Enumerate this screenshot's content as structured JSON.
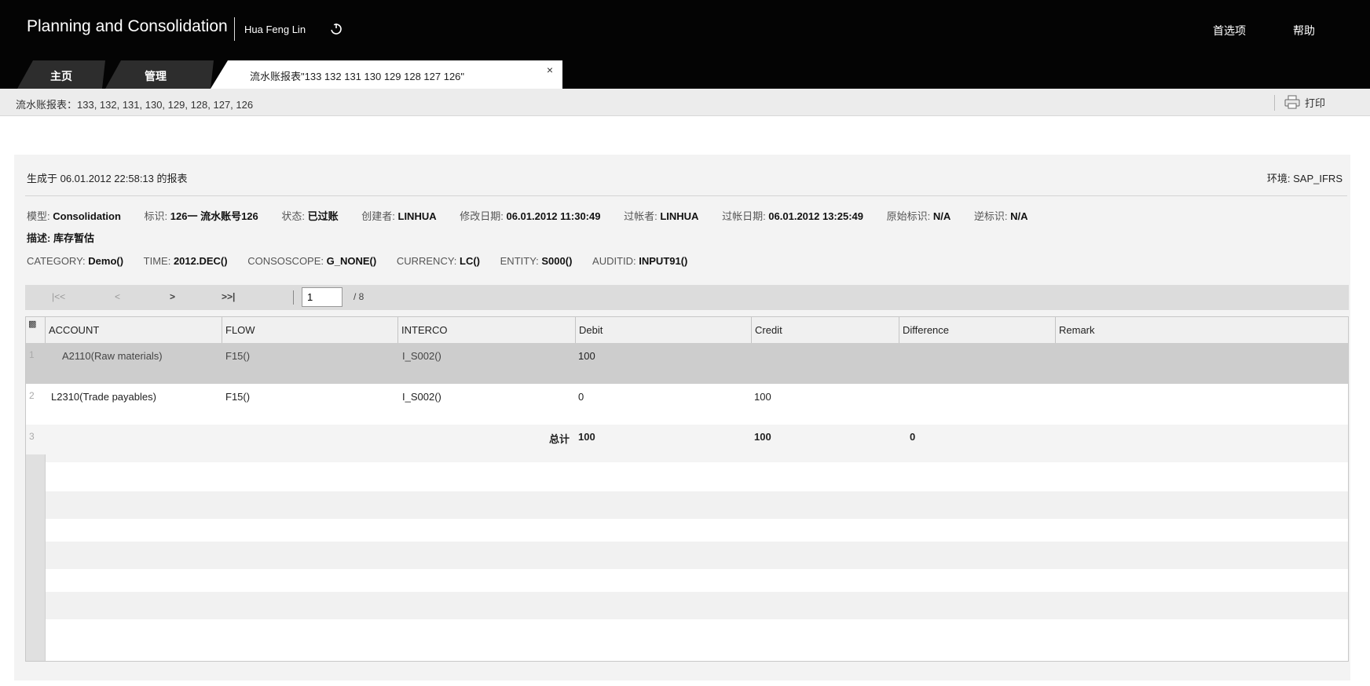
{
  "header": {
    "app_title": "Planning and Consolidation",
    "user": "Hua Feng Lin",
    "links": [
      "首选项",
      "帮助"
    ]
  },
  "tabs": [
    {
      "label": "主页"
    },
    {
      "label": "管理"
    },
    {
      "label": "流水账报表\"133 132 131 130 129 128 127 126\"",
      "close": "×"
    }
  ],
  "subbar": {
    "title": "流水账报表：133, 132, 131, 130, 129, 128, 127, 126",
    "print_label": "打印"
  },
  "report": {
    "generated": "生成于 06.01.2012 22:58:13 的报表",
    "env_label": "环境: ",
    "env_value": "SAP_IFRS",
    "meta": [
      {
        "label": "模型: ",
        "value": "Consolidation"
      },
      {
        "label": "标识: ",
        "value": "126一 流水账号126"
      },
      {
        "label": "状态: ",
        "value": "已过账"
      },
      {
        "label": "创建者: ",
        "value": "LINHUA"
      },
      {
        "label": "修改日期: ",
        "value": "06.01.2012 11:30:49"
      },
      {
        "label": "过帐者: ",
        "value": "LINHUA"
      },
      {
        "label": "过帐日期: ",
        "value": "06.01.2012 13:25:49"
      },
      {
        "label": "原始标识: ",
        "value": "N/A"
      },
      {
        "label": "逆标识: ",
        "value": "N/A"
      }
    ],
    "description_label": "描述: ",
    "description_value": "库存暂估",
    "dims": [
      {
        "label": "CATEGORY: ",
        "value": "Demo()"
      },
      {
        "label": "TIME: ",
        "value": "2012.DEC()"
      },
      {
        "label": "CONSOSCOPE: ",
        "value": "G_NONE()"
      },
      {
        "label": "CURRENCY: ",
        "value": "LC()"
      },
      {
        "label": "ENTITY: ",
        "value": "S000()"
      },
      {
        "label": "AUDITID: ",
        "value": "INPUT91()"
      }
    ]
  },
  "pager": {
    "first": "|<<",
    "prev": "<",
    "next": ">",
    "last": ">>|",
    "page": "1",
    "total": "/ 8"
  },
  "table": {
    "columns": [
      "ACCOUNT",
      "FLOW",
      "INTERCO",
      "Debit",
      "Credit",
      "Difference",
      "Remark"
    ],
    "rows": [
      {
        "num": "1",
        "account": "A2110(Raw materials)",
        "flow": "F15()",
        "interco": "I_S002()",
        "debit": "100",
        "credit": "",
        "difference": "",
        "remark": ""
      },
      {
        "num": "2",
        "account": "L2310(Trade payables)",
        "flow": "F15()",
        "interco": "I_S002()",
        "debit": "0",
        "credit": "100",
        "difference": "",
        "remark": ""
      }
    ],
    "total": {
      "num": "3",
      "label": "总计",
      "debit": "100",
      "credit": "100",
      "difference": "0"
    }
  }
}
